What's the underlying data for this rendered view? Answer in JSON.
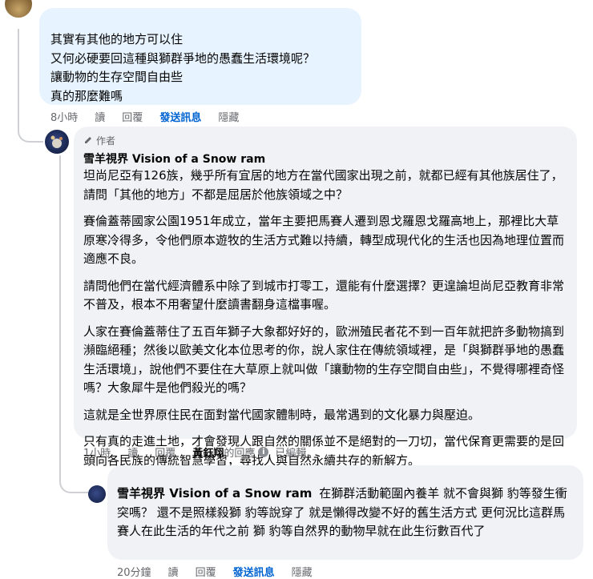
{
  "comment1": {
    "lines": [
      "其實有其他的地方可以住",
      "又何必硬要回這種與獅群爭地的愚蠢生活環境呢？",
      "讓動物的生存空間自由些",
      "真的那麼難嗎"
    ],
    "actions": {
      "time": "8小時",
      "read": "讀",
      "reply": "回覆",
      "send": "發送訊息",
      "hide": "隱藏"
    }
  },
  "comment2": {
    "badge": "作者",
    "author": "雪羊視界 Vision of a Snow ram",
    "paragraphs": [
      "坦尚尼亞有126族，幾乎所有宜居的地方在當代國家出現之前，就都已經有其他族居住了，請問「其他的地方」不都是屈居於他族領域之中？",
      "賽倫蓋蒂國家公園1951年成立，當年主要把馬賽人遷到恩戈羅恩戈羅高地上，那裡比大草原寒冷得多，令他們原本遊牧的生活方式難以持續，轉型成現代化的生活也因為地理位置而適應不良。",
      "請問他們在當代經濟體系中除了到城市打零工，還能有什麼選擇？更遑論坦尚尼亞教育非常不普及，根本不用奢望什麼讀書翻身這檔事喔。",
      "人家在賽倫蓋蒂住了五百年獅子大象都好好的，歐洲殖民者花不到一百年就把許多動物搞到瀕臨絕種；然後以歐美文化本位思考的你，說人家住在傳統領域裡，是「與獅群爭地的愚蠢生活環境」，說他們不要住在大草原上就叫做「讓動物的生存空間自由些」，不覺得哪裡奇怪嗎？大象犀牛是他們殺光的嗎？",
      "這就是全世界原住民在面對當代國家體制時，最常遇到的文化暴力與壓迫。",
      "只有真的走進土地，才會發現人跟自然的關係並不是絕對的一刀切，當代保育更需要的是回頭向各民族的傳統智慧學習，尋找人與自然永續共存的新解方。"
    ],
    "actions": {
      "time": "1小時",
      "read": "讀",
      "reply": "回覆",
      "replied_by": "黃鈺翔",
      "replied_suffix": "的回應",
      "info_icon": "info-icon",
      "edited": "已編輯"
    }
  },
  "comment3": {
    "author": "雪羊視界 Vision of a Snow ram",
    "text": "在獅群活動範圍內養羊 就不會與獅 豹等發生衝突嗎？ 還不是照樣殺獅 豹等說穿了 就是懶得改變不好的舊生活方式 更何況比這群馬賽人在此生活的年代之前 獅 豹等自然界的動物早就在此生衍數百代了",
    "actions": {
      "time": "20分鐘",
      "read": "讀",
      "reply": "回覆",
      "send": "發送訊息",
      "hide": "隱藏"
    }
  },
  "colors": {
    "bubble": "#f0f2f5",
    "link": "#0064d1",
    "meta": "#65676b",
    "text": "#050505"
  }
}
